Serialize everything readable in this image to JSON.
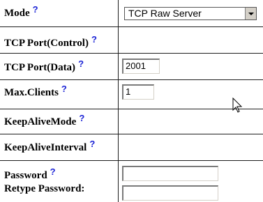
{
  "form": {
    "mode": {
      "label": "Mode",
      "help": "?",
      "value": "TCP Raw Server"
    },
    "tcp_port_control": {
      "label": "TCP Port(Control)",
      "help": "?"
    },
    "tcp_port_data": {
      "label": "TCP Port(Data)",
      "help": "?",
      "value": "2001"
    },
    "max_clients": {
      "label": "Max.Clients",
      "help": "?",
      "value": "1"
    },
    "keepalive_mode": {
      "label": "KeepAliveMode",
      "help": "?"
    },
    "keepalive_interval": {
      "label": "KeepAliveInterval",
      "help": "?"
    },
    "password": {
      "label": "Password",
      "help": "?",
      "value": ""
    },
    "retype_password": {
      "label": "Retype Password:",
      "value": ""
    }
  },
  "colors": {
    "help": "#1b23d6",
    "grid": "#1d1d1d"
  },
  "icons": {
    "cursor": "mouse-pointer-icon"
  }
}
